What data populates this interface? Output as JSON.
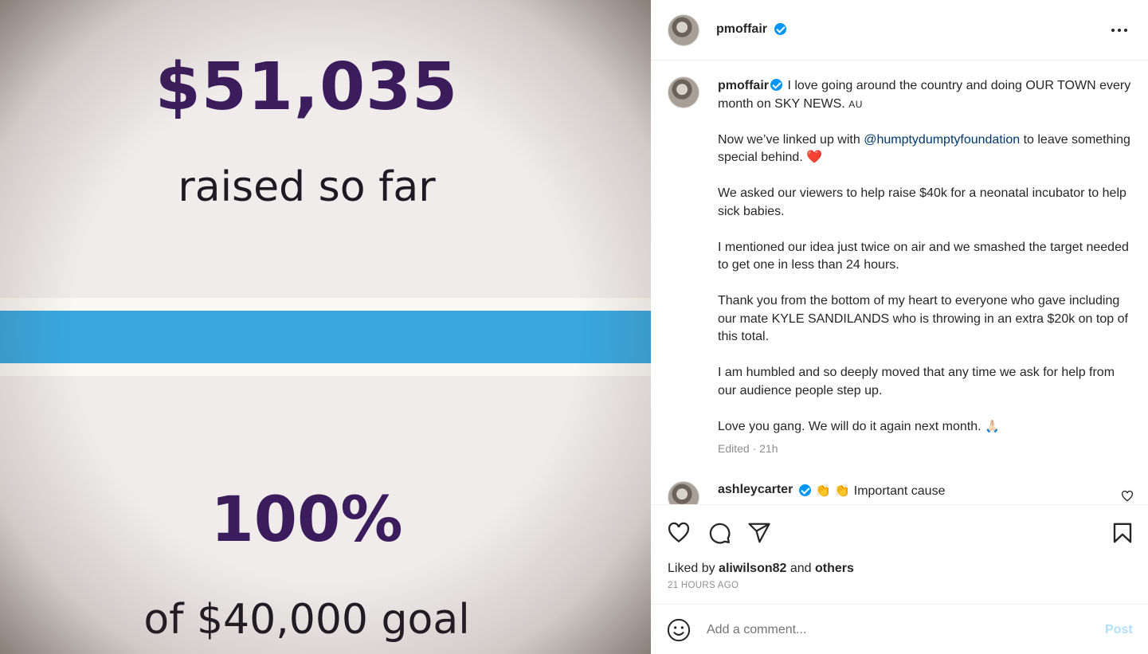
{
  "media": {
    "amount": "$51,035",
    "raised_text": "raised so far",
    "percent": "100%",
    "goal_text": "of $40,000 goal"
  },
  "header": {
    "username": "pmoffair",
    "avatar_icon": "avatar",
    "more_icon": "more-options-icon"
  },
  "caption": {
    "username": "pmoffair",
    "p1_text": "I love going around the country and doing OUR TOWN every month on SKY NEWS.",
    "p1_suffix": "AU",
    "p2_before": "Now we’ve linked up with ",
    "p2_mention": "@humptydumptyfoundation",
    "p2_after": " to leave something special behind. ",
    "p2_emoji": "❤️",
    "p3": "We asked our viewers to help raise $40k for a neonatal incubator to help sick babies.",
    "p4": "I mentioned our idea just twice on air and we smashed the target needed to get one in less than 24 hours.",
    "p5": "Thank you from the bottom of my heart to everyone who gave including our mate KYLE SANDILANDS who is throwing in an extra $20k on top of this total.",
    "p6": "I am humbled and so deeply moved that any time we ask for help from our audience people step up.",
    "p7": "Love you gang. We will do it again next month. ",
    "p7_emoji": "🙏🏻",
    "edited": "Edited · 21h"
  },
  "comment": {
    "username": "ashleycarter",
    "emoji": "👏 👏",
    "text": "Important cause"
  },
  "actions": {
    "liked_prefix": "Liked by ",
    "liked_user": "aliwilson82",
    "liked_and": " and ",
    "liked_others": "others",
    "time": "21 HOURS AGO"
  },
  "comment_bar": {
    "placeholder": "Add a comment...",
    "post_label": "Post"
  },
  "colors": {
    "verified": "#0095f6",
    "mention": "#00376b",
    "post_disabled": "#b2dffc",
    "banner_blue": "#39a8df",
    "banner_text": "#3b1c5c"
  }
}
